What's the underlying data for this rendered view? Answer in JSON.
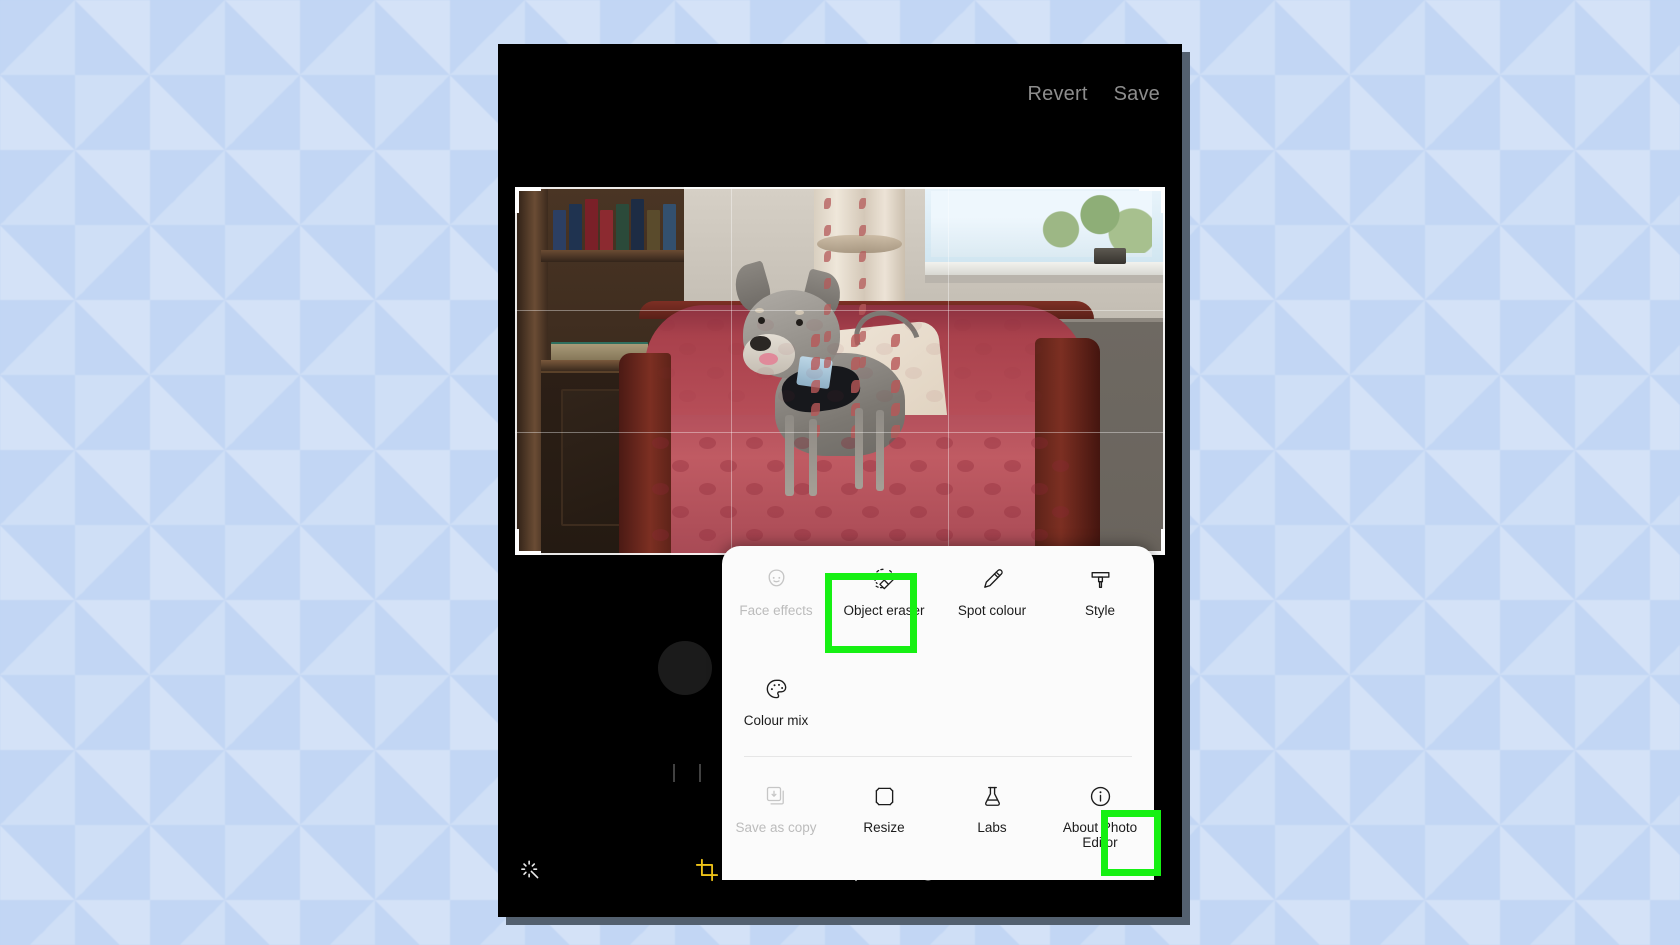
{
  "app": {
    "name": "Photo Editor",
    "accent_green": "#16f013",
    "sheet_bg": "#fbfbfb",
    "screen_bg": "#000000"
  },
  "topbar": {
    "revert_label": "Revert",
    "save_label": "Save"
  },
  "photo": {
    "alt": "Chihuahua dog standing on a pink patterned armchair in front of a bookcase and window",
    "crop_grid": "rule-of-thirds"
  },
  "popup_menu": {
    "tools": [
      {
        "label": "Face effects",
        "icon": "face-icon",
        "disabled": true,
        "highlighted": false
      },
      {
        "label": "Object eraser",
        "icon": "object-eraser-icon",
        "disabled": false,
        "highlighted": true
      },
      {
        "label": "Spot colour",
        "icon": "eyedropper-icon",
        "disabled": false,
        "highlighted": false
      },
      {
        "label": "Style",
        "icon": "paint-brush-icon",
        "disabled": false,
        "highlighted": false
      }
    ],
    "tools_row2": [
      {
        "label": "Colour mix",
        "icon": "palette-icon",
        "disabled": false,
        "highlighted": false
      }
    ],
    "extras": [
      {
        "label": "Save as copy",
        "icon": "save-copy-icon",
        "disabled": true,
        "highlighted": false
      },
      {
        "label": "Resize",
        "icon": "resize-icon",
        "disabled": false,
        "highlighted": false
      },
      {
        "label": "Labs",
        "icon": "flask-icon",
        "disabled": false,
        "highlighted": false
      },
      {
        "label": "About Photo\nEditor",
        "icon": "info-icon",
        "disabled": false,
        "highlighted": false
      }
    ]
  },
  "bottom_toolbar": [
    {
      "name": "auto-enhance",
      "icon": "sparkle-icon",
      "active": false
    },
    {
      "name": "crop",
      "icon": "crop-icon",
      "active": true
    },
    {
      "name": "filters",
      "icon": "filters-icon",
      "active": false
    },
    {
      "name": "adjust",
      "icon": "brightness-icon",
      "active": false
    },
    {
      "name": "markup",
      "icon": "smiley-icon",
      "active": false
    },
    {
      "name": "more",
      "icon": "more-vert-icon",
      "active": false
    }
  ],
  "annotations": [
    {
      "target": "Object eraser",
      "colour": "#16f013"
    },
    {
      "target": "more-vert-icon",
      "colour": "#16f013"
    }
  ]
}
